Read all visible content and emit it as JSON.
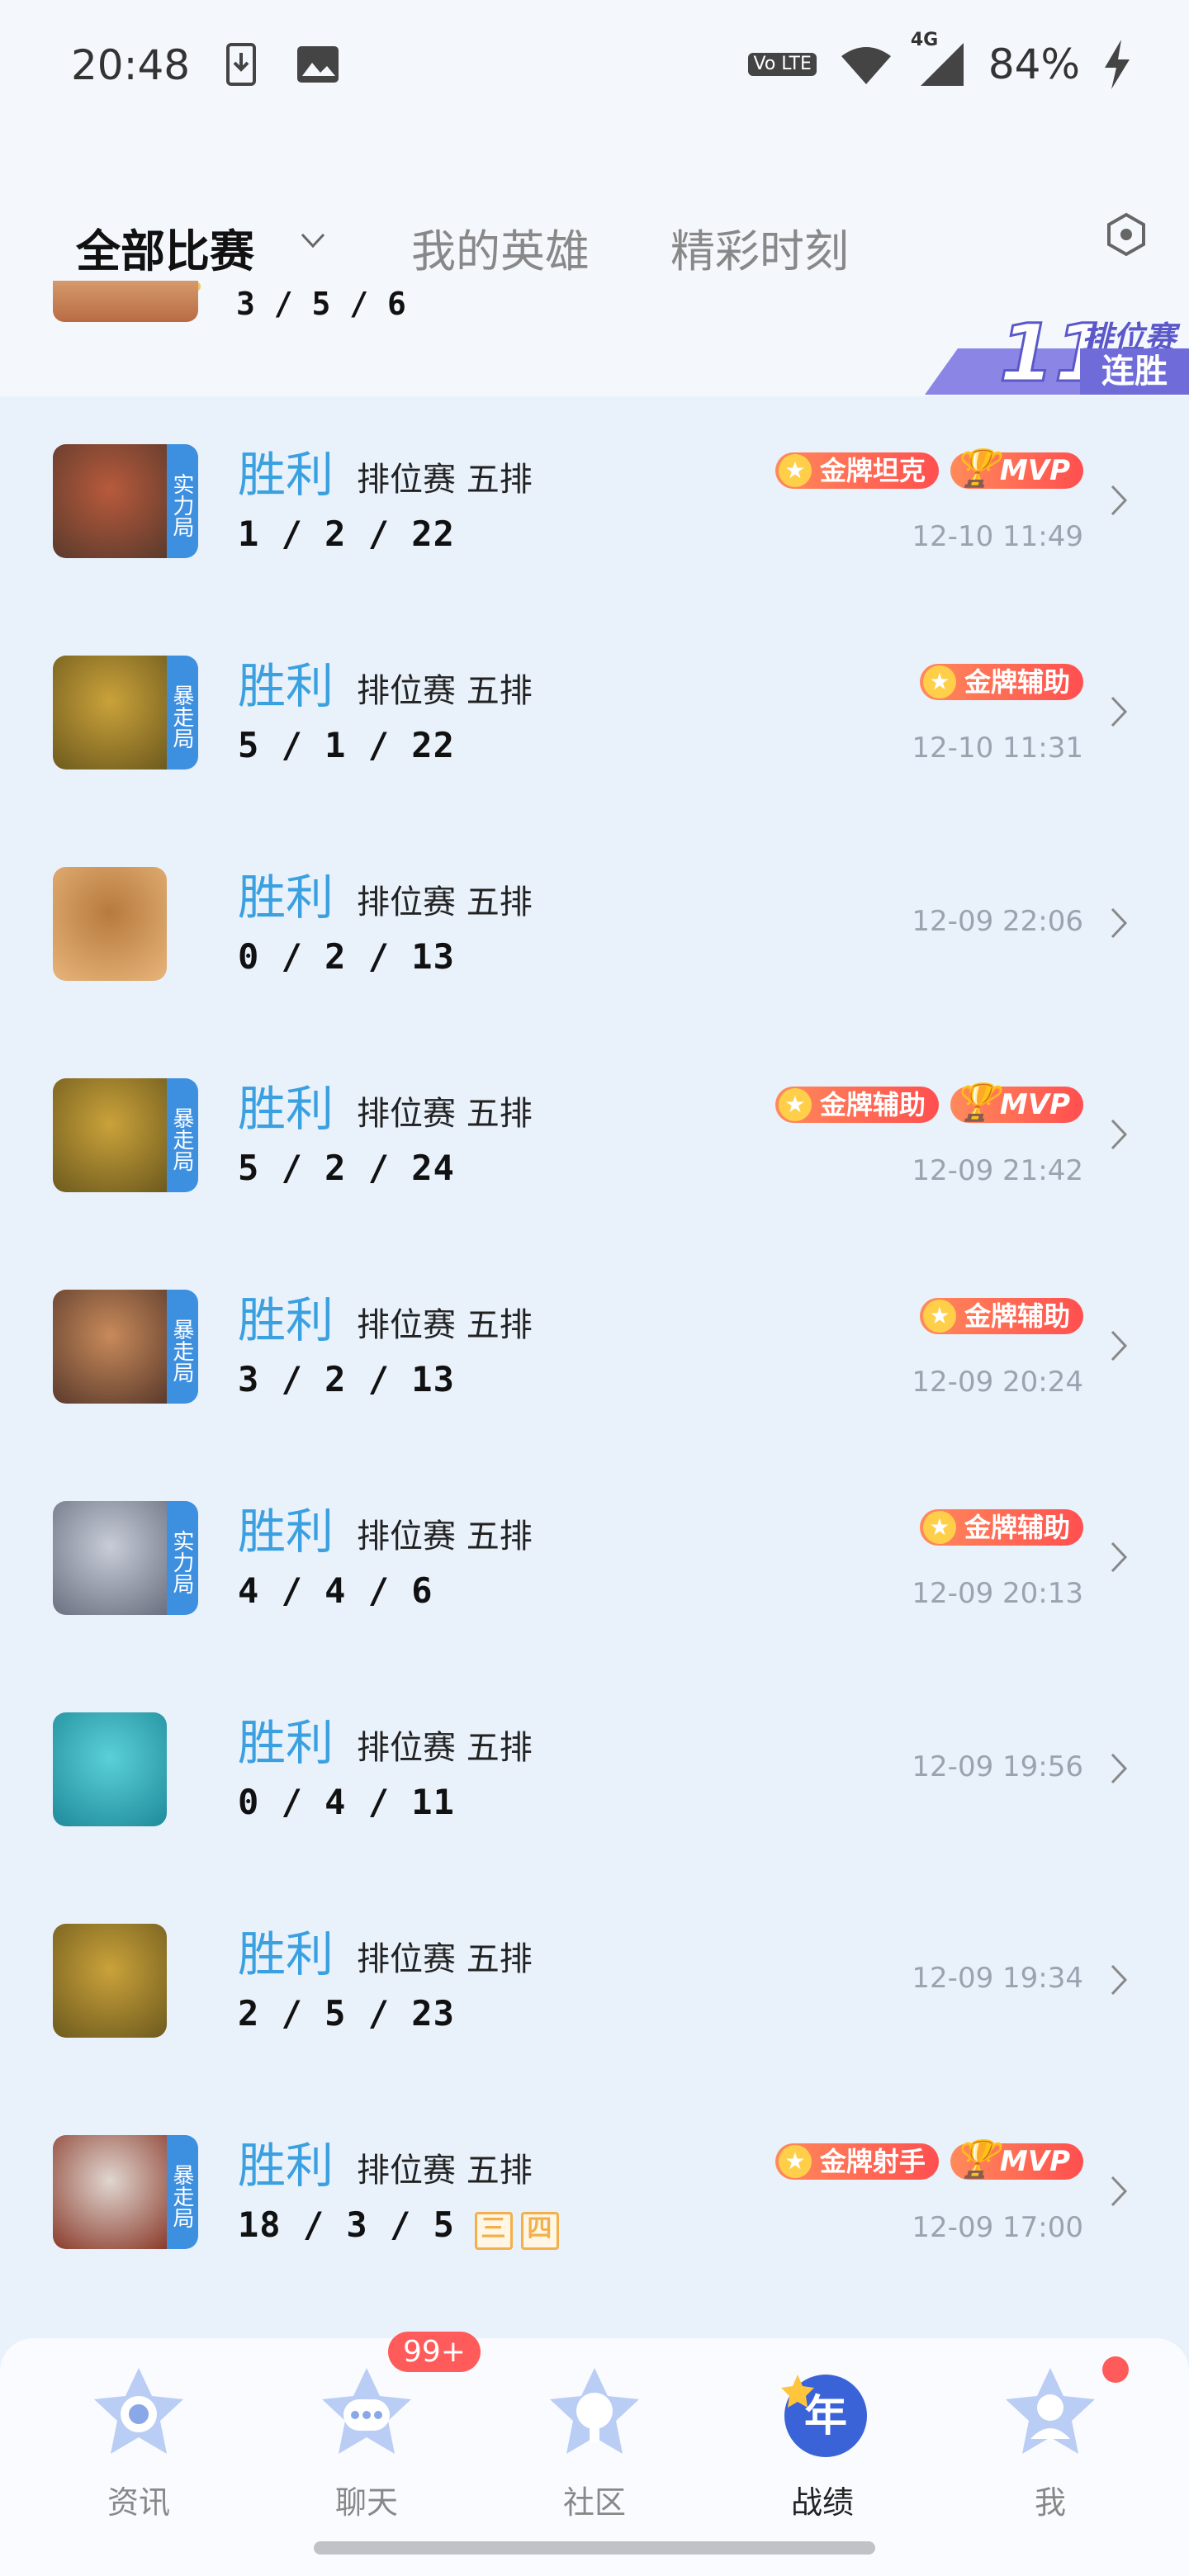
{
  "status": {
    "time": "20:48",
    "battery": "84%",
    "network": "4G",
    "volte": "Vo LTE"
  },
  "tabs": {
    "all": "全部比赛",
    "heroes": "我的英雄",
    "moments": "精彩时刻"
  },
  "peek": {
    "kda": "3 / 5 / 6"
  },
  "streak": {
    "count": "11",
    "line1": "排位赛",
    "line2": "连胜"
  },
  "matches": [
    {
      "tag": "实力局",
      "result": "胜利",
      "mode": "排位赛 五排",
      "kda": "1 / 2 / 22",
      "badge": "金牌坦克",
      "mvp": "MVP",
      "time": "12-10 11:49"
    },
    {
      "tag": "暴走局",
      "result": "胜利",
      "mode": "排位赛 五排",
      "kda": "5 / 1 / 22",
      "badge": "金牌辅助",
      "mvp": "",
      "time": "12-10 11:31"
    },
    {
      "tag": "",
      "result": "胜利",
      "mode": "排位赛 五排",
      "kda": "0 / 2 / 13",
      "badge": "",
      "mvp": "",
      "time": "12-09 22:06"
    },
    {
      "tag": "暴走局",
      "result": "胜利",
      "mode": "排位赛 五排",
      "kda": "5 / 2 / 24",
      "badge": "金牌辅助",
      "mvp": "MVP",
      "time": "12-09 21:42"
    },
    {
      "tag": "暴走局",
      "result": "胜利",
      "mode": "排位赛 五排",
      "kda": "3 / 2 / 13",
      "badge": "金牌辅助",
      "mvp": "",
      "time": "12-09 20:24"
    },
    {
      "tag": "实力局",
      "result": "胜利",
      "mode": "排位赛 五排",
      "kda": "4 / 4 / 6",
      "badge": "金牌辅助",
      "mvp": "",
      "time": "12-09 20:13"
    },
    {
      "tag": "",
      "result": "胜利",
      "mode": "排位赛 五排",
      "kda": "0 / 4 / 11",
      "badge": "",
      "mvp": "",
      "time": "12-09 19:56"
    },
    {
      "tag": "",
      "result": "胜利",
      "mode": "排位赛 五排",
      "kda": "2 / 5 / 23",
      "badge": "",
      "mvp": "",
      "time": "12-09 19:34"
    },
    {
      "tag": "暴走局",
      "result": "胜利",
      "mode": "排位赛 五排",
      "kda": "18 / 3 / 5",
      "badge": "金牌射手",
      "mvp": "MVP",
      "time": "12-09 17:00",
      "extras": [
        "三",
        "四"
      ]
    }
  ],
  "nav": {
    "news": "资讯",
    "chat": "聊天",
    "chat_badge": "99+",
    "community": "社区",
    "record": "战绩",
    "record_icon_text": "年",
    "me": "我"
  },
  "colors": {
    "accent": "#3aa0e0",
    "tag_blue": "#3d8fe0",
    "badge_red": "#ff4f4f"
  }
}
